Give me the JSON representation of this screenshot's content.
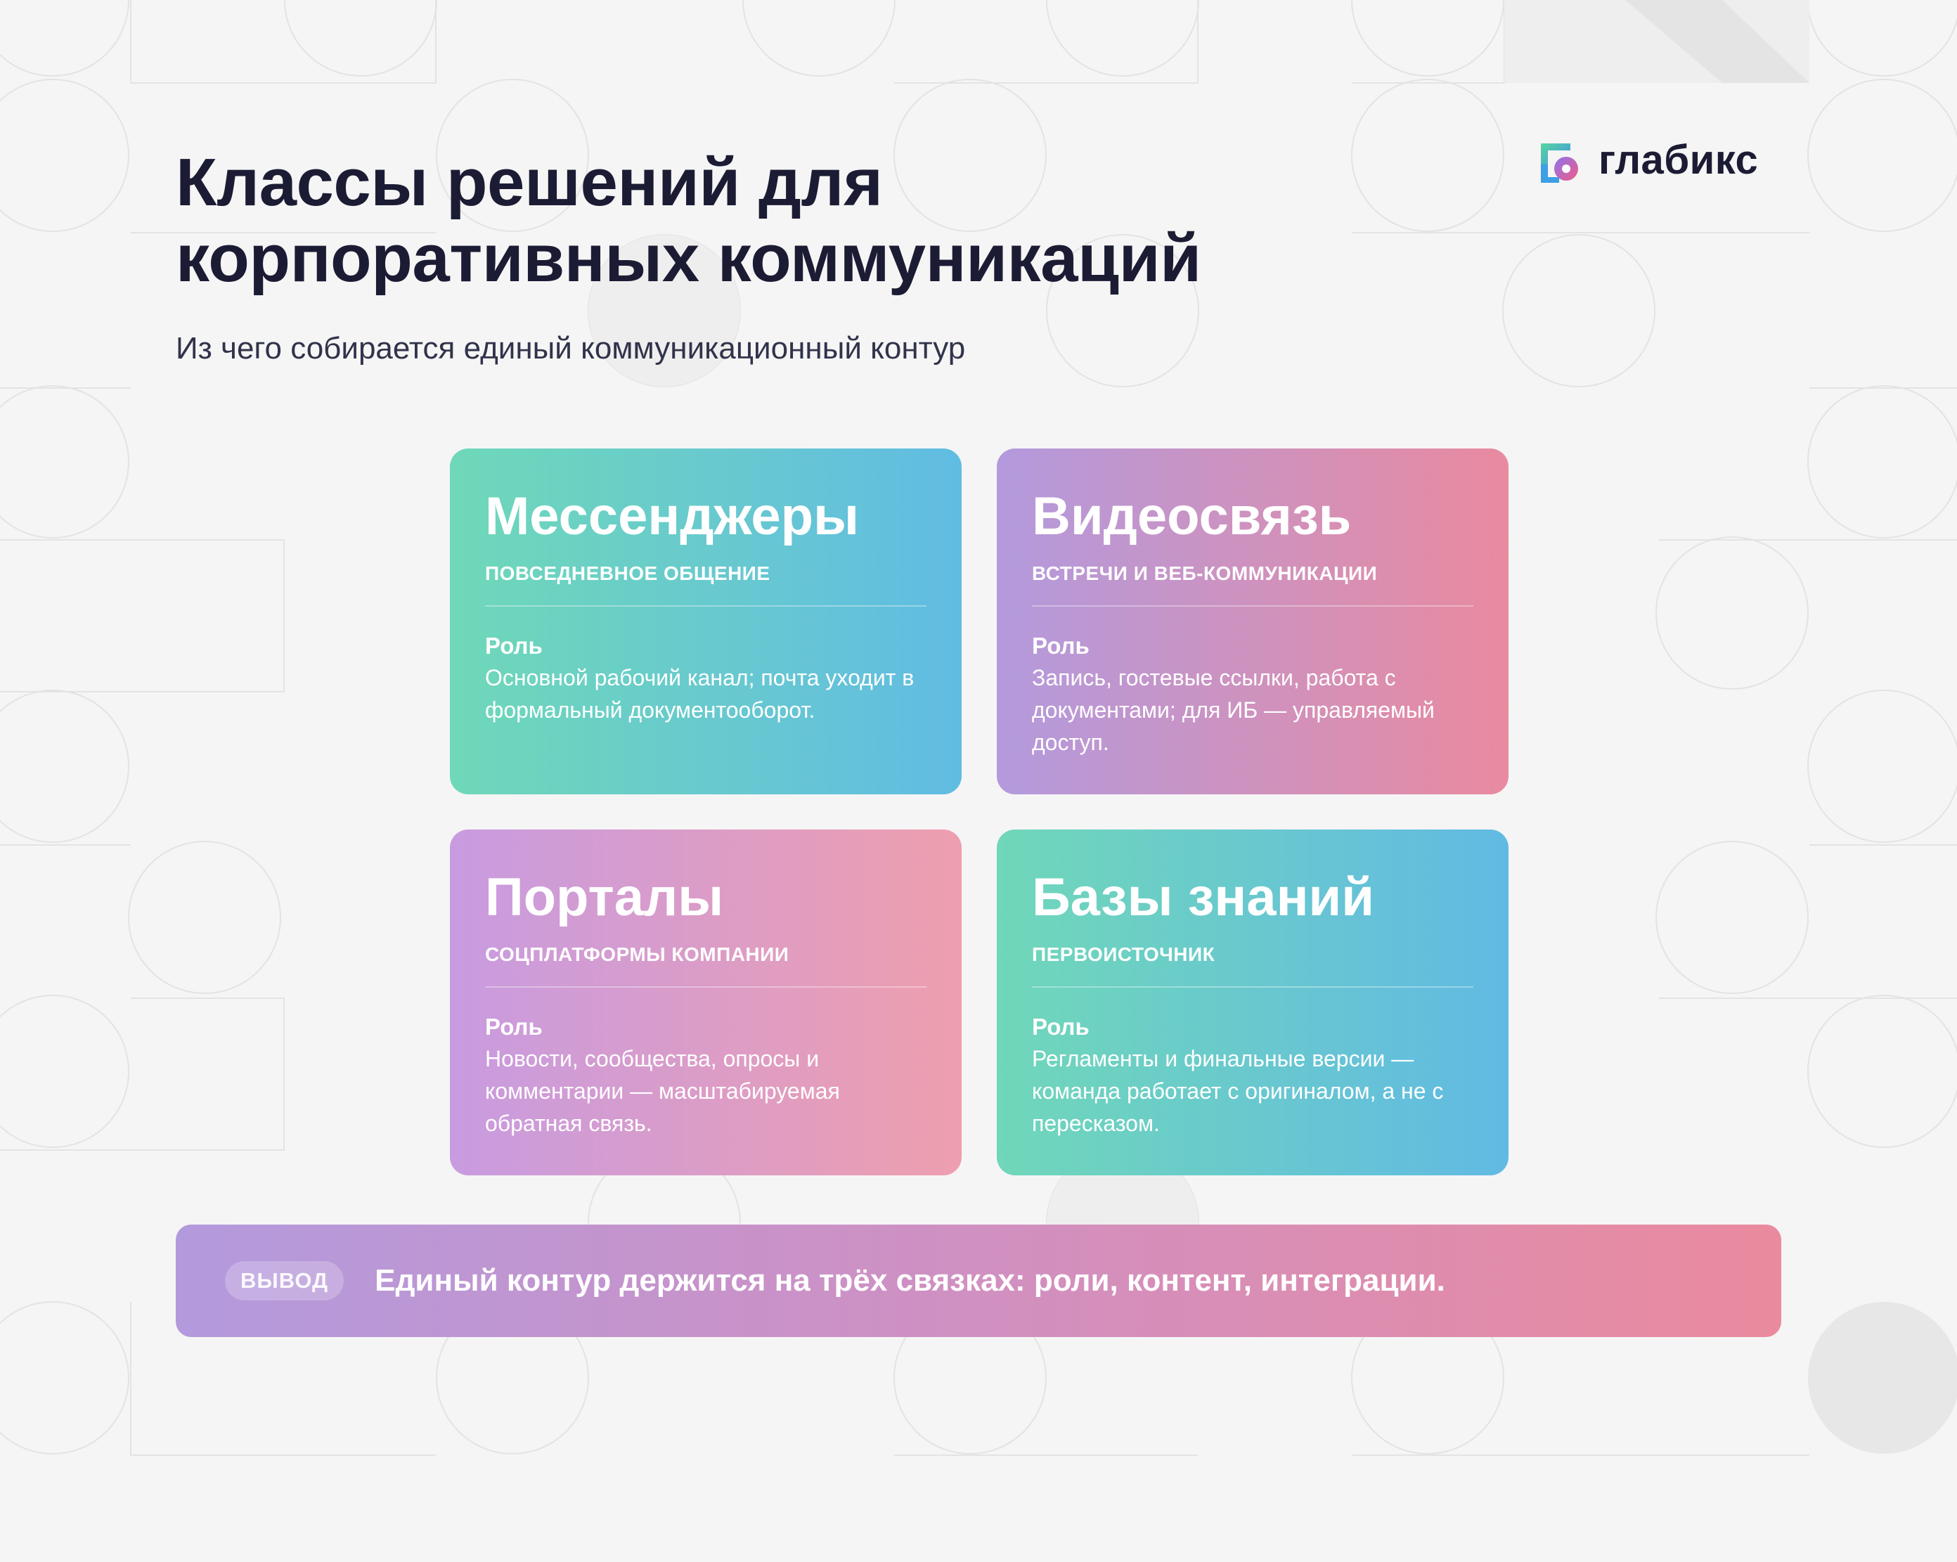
{
  "page": {
    "background": "#f5f5f5",
    "title_lines": [
      "Классы решений для",
      "корпоративных коммуникаций"
    ],
    "subtitle": "Из чего собирается единый коммуникационный контур"
  },
  "logo": {
    "text": "глабикс",
    "icon": "glabix-logo-icon"
  },
  "cards": [
    {
      "title": "Мессенджеры",
      "subtitle": "повседневное общение",
      "role_label": "Роль",
      "description": "Основной рабочий канал; почта уходит в формальный документооборот.",
      "colors": [
        "#6fd8b8",
        "#61bce3"
      ]
    },
    {
      "title": "Видеосвязь",
      "subtitle": "встречи и веб-коммуникации",
      "role_label": "Роль",
      "description": "Запись, гостевые ссылки, работа с документами; для ИБ — управляемый доступ.",
      "colors": [
        "#b39add",
        "#e98a9f"
      ]
    },
    {
      "title": "Порталы",
      "subtitle": "соцплатформы компании",
      "role_label": "Роль",
      "description": "Новости, сообщества, опросы и комментарии — масштабируемая обратная связь.",
      "colors": [
        "#c89be0",
        "#ee9eae"
      ]
    },
    {
      "title": "Базы знаний",
      "subtitle": "первоисточник",
      "role_label": "Роль",
      "description": "Регламенты и финальные версии — команда работает с оригиналом, а не с пересказом.",
      "colors": [
        "#70d7b9",
        "#61bae3"
      ]
    }
  ],
  "conclusion": {
    "badge": "вывод",
    "text": "Единый контур держится на трёх связках: роли, контент, интеграции.",
    "colors": [
      "#b39add",
      "#ea8a9e"
    ]
  }
}
